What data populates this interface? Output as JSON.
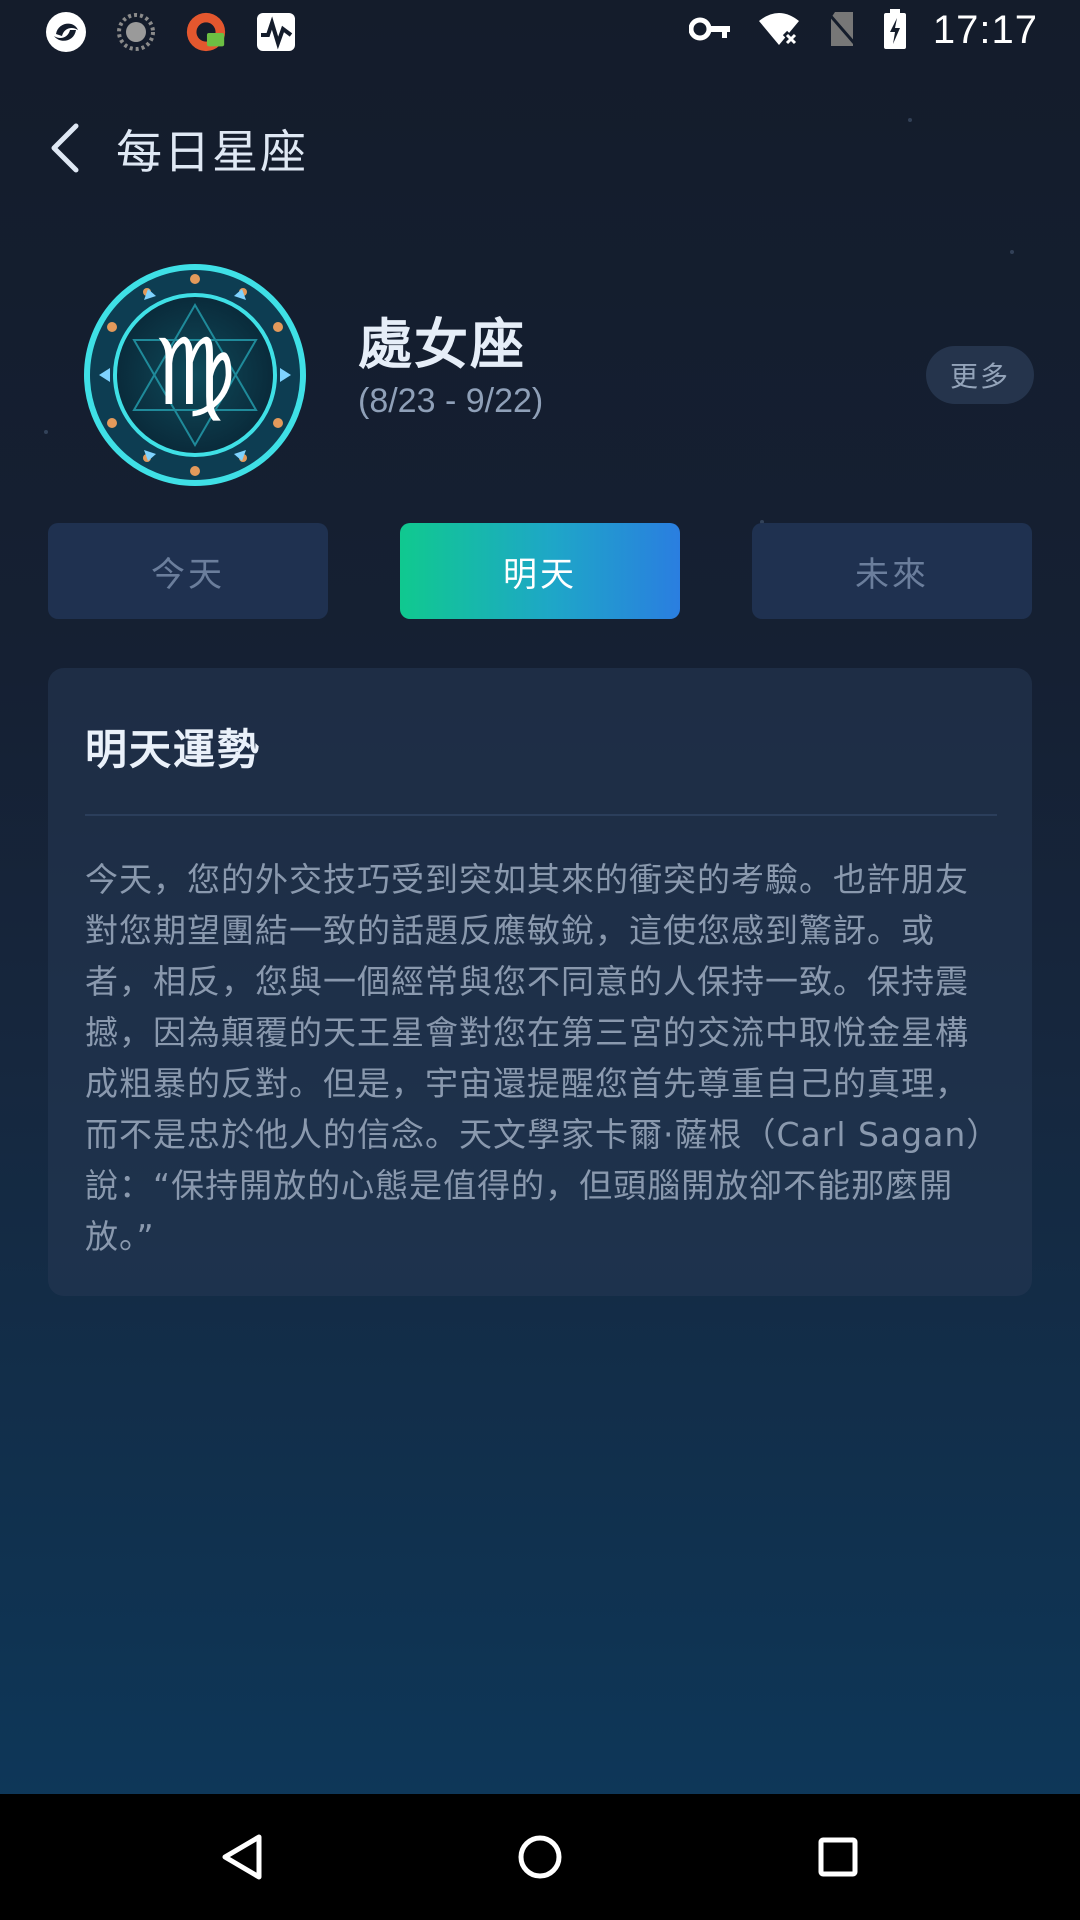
{
  "status_bar": {
    "time": "17:17",
    "left_icons": [
      "app-logo-icon",
      "loading-spinner-icon",
      "vpn-app-icon",
      "activity-monitor-icon"
    ],
    "right_icons": [
      "vpn-key-icon",
      "wifi-icon",
      "no-sim-icon",
      "battery-charging-icon"
    ]
  },
  "header": {
    "title": "每日星座",
    "back_icon": "chevron-left-icon"
  },
  "sign": {
    "name": "處女座",
    "date_range": "(8/23 - 9/22)",
    "symbol": "♍",
    "more_label": "更多"
  },
  "tabs": [
    {
      "label": "今天",
      "active": false
    },
    {
      "label": "明天",
      "active": true
    },
    {
      "label": "未來",
      "active": false
    }
  ],
  "horoscope": {
    "title": "明天運勢",
    "body": "今天，您的外交技巧受到突如其來的衝突的考驗。也許朋友對您期望團結一致的話題反應敏銳，這使您感到驚訝。或者，相反，您與一個經常與您不同意的人保持一致。保持震撼，因為顛覆的天王星會對您在第三宮的交流中取悅金星構成粗暴的反對。但是，宇宙還提醒您首先尊重自己的真理，而不是忠於他人的信念。天文學家卡爾·薩根（Carl Sagan）說：“保持開放的心態是值得的，但頭腦開放卻不能那麼開放。”"
  },
  "nav": {
    "back_icon": "nav-back-icon",
    "home_icon": "nav-home-icon",
    "recents_icon": "nav-recents-icon"
  },
  "colors": {
    "accent_gradient_start": "#10c98f",
    "accent_gradient_end": "#2a7ee0",
    "tab_inactive_bg": "#1f3150",
    "background_top": "#141c2b",
    "background_bottom": "#0d3a5e"
  }
}
